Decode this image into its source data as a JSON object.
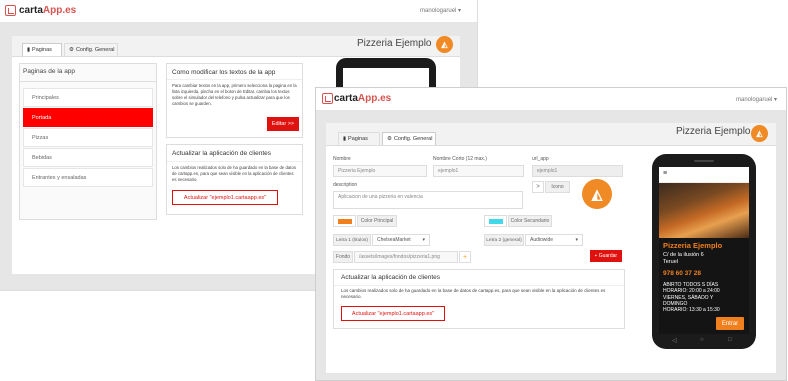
{
  "back": {
    "brand_prefix": "carta",
    "brand_suffix": "App.es",
    "user": "manologaruel ▾",
    "title": "Pizzeria Ejemplo",
    "tabs": [
      "Paginas",
      "Config. General"
    ],
    "pages_header": "Paginas de la app",
    "pages": [
      "Principales",
      "Portada",
      "Pizzas",
      "Bebidas",
      "Entrantes y ensaladas"
    ],
    "help_title": "Como modificar los textos de la app",
    "help_text": "Para cambiar textos en la app, primero selecciona la pagina en la lista izquierda, pincha en el boton de Editar, cambia los textos sobre el simulador del telefono y pulsa actualizar para que los cambios se guarden.",
    "edit_button": "Editar >>",
    "update_title": "Actualizar la aplicación de clientes",
    "update_text": "Los cambios realizados solo de ha guardado en la base de datos de cartapp.es, para que sean visible en la aplicación de clientes es necesario.",
    "update_button": "Actualizar \"ejemplo1.cartaapp.es\""
  },
  "front": {
    "brand_prefix": "carta",
    "brand_suffix": "App.es",
    "user": "manologaruel ▾",
    "title": "Pizzeria Ejemplo",
    "tabs": [
      "Paginas",
      "Config. General"
    ],
    "labels": {
      "nombre": "Nombre",
      "nombre_corto": "Nombre Corto (12 max.)",
      "url_app": "url_app",
      "description": "description"
    },
    "values": {
      "nombre": "Pizzeria Ejemplo",
      "nombre_corto": "ejemplo1",
      "url_app": "ejemplo1",
      "description": "Aplicacion de una pizzeria en valencia",
      "color_principal": "Color Principal",
      "color_secundario": "Color Secundario",
      "letra1_label": "Letra 1 (titulos)",
      "letra1_value": "ChelseaMarket",
      "letra2_label": "Letra 2 (general)",
      "letra2_value": "Audiowide",
      "fondo_label": "Fondo",
      "fondo_value": "/assets/images/fondos/pizzeria1.png",
      "icono_label": "Icono",
      "guardar": "Guardar"
    },
    "colors": {
      "principal": "#f07f1e",
      "secundario": "#41d9e8"
    },
    "update_title": "Actualizar la aplicación de clientes",
    "update_text": "Los cambios realizados solo de ha guardado en la base de datos de cartapp.es, para que sean visible en la aplicación de clientes es necesario.",
    "update_button": "Actualizar \"ejemplo1.cartaapp.es\"",
    "phone": {
      "name": "Pizzeria Ejemplo",
      "address": "C/ de la ilusión 6\nTeruel",
      "phone": "978 60 37 28",
      "hours": "ABIRTO TODOS S DÍAS\nHORARIO: 20:00 a 24:00\nVIERNES, SÁBADO Y\nDOMINGO\nHORARIO: 13:30 a 15:30",
      "enter": "Entrar"
    }
  }
}
